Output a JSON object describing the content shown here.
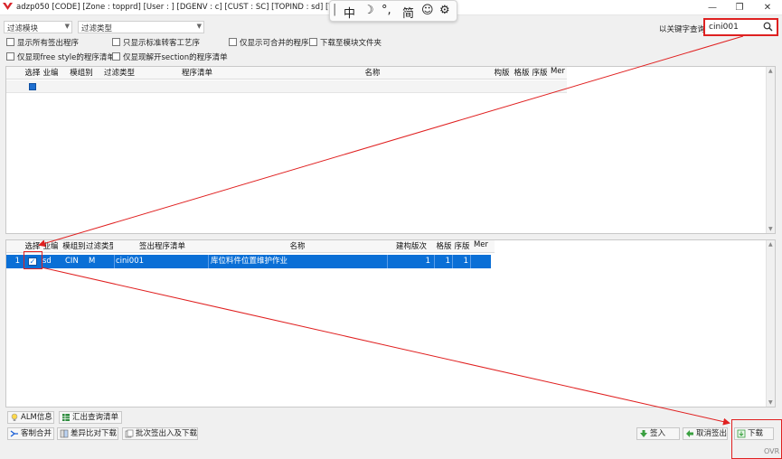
{
  "titlebar": {
    "title": "adzp050 [CODE] [Zone : topprd] [User :           ] [DGENV : c] [CUST : SC] [TOPIND : sd] [TOF",
    "minimize": "—",
    "restore": "❐",
    "close": "✕"
  },
  "ime": {
    "cursor": "|",
    "mode": "中",
    "moon": "☽",
    "punct": "°,",
    "simplified": "简",
    "emoji": "☺",
    "settings": "⚙"
  },
  "filters": {
    "module_label": "过滤模块",
    "type_label": "过滤类型",
    "options": [
      "显示所有签出程序",
      "只显示标准转客工艺序",
      "仅显示可合并的程序",
      "下载至模块文件夹",
      "仅显现free style的程序清单",
      "仅显现解开section的程序清单"
    ],
    "keyword_label": "以关键字查询",
    "keyword_value": "cini001"
  },
  "top_grid": {
    "headers": [
      "选择",
      "业编",
      "模组别",
      "过滤类型",
      "程序清单",
      "名称",
      "构版",
      "格版",
      "序版",
      "Mer"
    ]
  },
  "bottom_grid": {
    "headers": [
      "选择",
      "业编",
      "模组别",
      "过滤类型",
      "签出程序清单",
      "名称",
      "建构版次",
      "格版",
      "序版",
      "Mer"
    ],
    "rows": [
      {
        "num": "1",
        "checked": "✓",
        "env": "sd",
        "module": "CIN",
        "type": "M",
        "program": "cini001",
        "name": "库位料件位置维护作业",
        "build_ver": "1",
        "format_ver": "1",
        "seq_ver": "1"
      }
    ]
  },
  "buttons": {
    "alm": "ALM信息",
    "export": "汇出查询清单",
    "merge": "客制合并",
    "diff_download": "差异比对下载",
    "batch": "批次签出入及下载",
    "checkin": "签入",
    "cancel_checkout": "取消签出",
    "download": "下载"
  },
  "status": {
    "ovr": "OVR"
  },
  "colors": {
    "selection": "#0a6fd6",
    "annotation": "#e02020"
  }
}
